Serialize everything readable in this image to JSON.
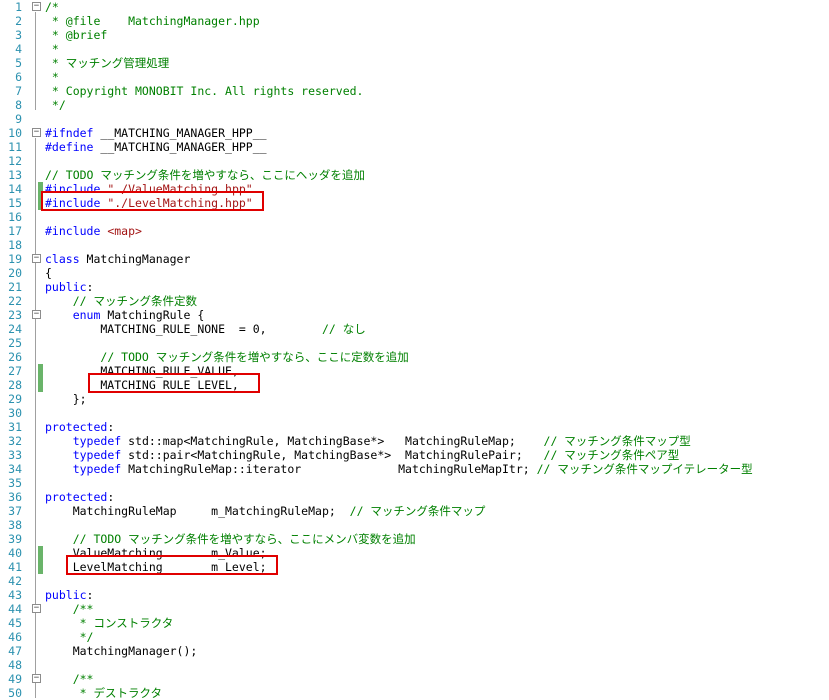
{
  "editor": {
    "language": "C++",
    "file": "MatchingManager.hpp",
    "lines": [
      {
        "n": "1",
        "fold": "-",
        "spans": [
          [
            "cm",
            "/*"
          ]
        ]
      },
      {
        "n": "2",
        "spans": [
          [
            "cm",
            " * @file    MatchingManager.hpp"
          ]
        ]
      },
      {
        "n": "3",
        "spans": [
          [
            "cm",
            " * @brief"
          ]
        ]
      },
      {
        "n": "4",
        "spans": [
          [
            "cm",
            " *"
          ]
        ]
      },
      {
        "n": "5",
        "spans": [
          [
            "cm",
            " * マッチング管理処理"
          ]
        ]
      },
      {
        "n": "6",
        "spans": [
          [
            "cm",
            " *"
          ]
        ]
      },
      {
        "n": "7",
        "spans": [
          [
            "cm",
            " * Copyright MONOBIT Inc. All rights reserved."
          ]
        ]
      },
      {
        "n": "8",
        "spans": [
          [
            "cm",
            " */"
          ]
        ]
      },
      {
        "n": "9",
        "spans": []
      },
      {
        "n": "10",
        "fold": "-",
        "spans": [
          [
            "pp",
            "#ifndef"
          ],
          [
            "tx",
            " __MATCHING_MANAGER_HPP__"
          ]
        ]
      },
      {
        "n": "11",
        "spans": [
          [
            "pp",
            "#define"
          ],
          [
            "tx",
            " __MATCHING_MANAGER_HPP__"
          ]
        ]
      },
      {
        "n": "12",
        "spans": []
      },
      {
        "n": "13",
        "spans": [
          [
            "cm",
            "// TODO マッチング条件を増やすなら、ここにヘッダを追加"
          ]
        ]
      },
      {
        "n": "14",
        "changed": true,
        "spans": [
          [
            "pp",
            "#include"
          ],
          [
            "tx",
            " "
          ],
          [
            "st",
            "\"./ValueMatching.hpp\""
          ]
        ]
      },
      {
        "n": "15",
        "changed": true,
        "spans": [
          [
            "pp",
            "#include"
          ],
          [
            "tx",
            " "
          ],
          [
            "st",
            "\"./LevelMatching.hpp\""
          ]
        ]
      },
      {
        "n": "16",
        "spans": []
      },
      {
        "n": "17",
        "spans": [
          [
            "pp",
            "#include"
          ],
          [
            "tx",
            " "
          ],
          [
            "st",
            "<map>"
          ]
        ]
      },
      {
        "n": "18",
        "spans": []
      },
      {
        "n": "19",
        "fold": "-",
        "spans": [
          [
            "kw",
            "class"
          ],
          [
            "tx",
            " MatchingManager"
          ]
        ]
      },
      {
        "n": "20",
        "spans": [
          [
            "tx",
            "{"
          ]
        ]
      },
      {
        "n": "21",
        "spans": [
          [
            "kw",
            "public"
          ],
          [
            "tx",
            ":"
          ]
        ]
      },
      {
        "n": "22",
        "spans": [
          [
            "tx",
            "    "
          ],
          [
            "cm",
            "// マッチング条件定数"
          ]
        ]
      },
      {
        "n": "23",
        "fold": "-",
        "spans": [
          [
            "tx",
            "    "
          ],
          [
            "kw",
            "enum"
          ],
          [
            "tx",
            " MatchingRule {"
          ]
        ]
      },
      {
        "n": "24",
        "spans": [
          [
            "tx",
            "        MATCHING_RULE_NONE  = 0,        "
          ],
          [
            "cm",
            "// なし"
          ]
        ]
      },
      {
        "n": "25",
        "spans": []
      },
      {
        "n": "26",
        "spans": [
          [
            "tx",
            "        "
          ],
          [
            "cm",
            "// TODO マッチング条件を増やすなら、ここに定数を追加"
          ]
        ]
      },
      {
        "n": "27",
        "changed": true,
        "spans": [
          [
            "tx",
            "        MATCHING_RULE_VALUE,"
          ]
        ]
      },
      {
        "n": "28",
        "changed": true,
        "spans": [
          [
            "tx",
            "        MATCHING_RULE_LEVEL,"
          ]
        ]
      },
      {
        "n": "29",
        "spans": [
          [
            "tx",
            "    };"
          ]
        ]
      },
      {
        "n": "30",
        "spans": []
      },
      {
        "n": "31",
        "spans": [
          [
            "kw",
            "protected"
          ],
          [
            "tx",
            ":"
          ]
        ]
      },
      {
        "n": "32",
        "spans": [
          [
            "tx",
            "    "
          ],
          [
            "kw",
            "typedef"
          ],
          [
            "tx",
            " std::map<MatchingRule, MatchingBase*>   MatchingRuleMap;    "
          ],
          [
            "cm",
            "// マッチング条件マップ型"
          ]
        ]
      },
      {
        "n": "33",
        "spans": [
          [
            "tx",
            "    "
          ],
          [
            "kw",
            "typedef"
          ],
          [
            "tx",
            " std::pair<MatchingRule, MatchingBase*>  MatchingRulePair;   "
          ],
          [
            "cm",
            "// マッチング条件ペア型"
          ]
        ]
      },
      {
        "n": "34",
        "spans": [
          [
            "tx",
            "    "
          ],
          [
            "kw",
            "typedef"
          ],
          [
            "tx",
            " MatchingRuleMap::iterator              MatchingRuleMapItr; "
          ],
          [
            "cm",
            "// マッチング条件マップイテレーター型"
          ]
        ]
      },
      {
        "n": "35",
        "spans": []
      },
      {
        "n": "36",
        "spans": [
          [
            "kw",
            "protected"
          ],
          [
            "tx",
            ":"
          ]
        ]
      },
      {
        "n": "37",
        "spans": [
          [
            "tx",
            "    MatchingRuleMap     m_MatchingRuleMap;  "
          ],
          [
            "cm",
            "// マッチング条件マップ"
          ]
        ]
      },
      {
        "n": "38",
        "spans": []
      },
      {
        "n": "39",
        "spans": [
          [
            "tx",
            "    "
          ],
          [
            "cm",
            "// TODO マッチング条件を増やすなら、ここにメンバ変数を追加"
          ]
        ]
      },
      {
        "n": "40",
        "changed": true,
        "spans": [
          [
            "tx",
            "    ValueMatching       m_Value;"
          ]
        ]
      },
      {
        "n": "41",
        "changed": true,
        "spans": [
          [
            "tx",
            "    LevelMatching       m_Level;"
          ]
        ]
      },
      {
        "n": "42",
        "spans": []
      },
      {
        "n": "43",
        "spans": [
          [
            "kw",
            "public"
          ],
          [
            "tx",
            ":"
          ]
        ]
      },
      {
        "n": "44",
        "fold": "-",
        "spans": [
          [
            "tx",
            "    "
          ],
          [
            "cm",
            "/**"
          ]
        ]
      },
      {
        "n": "45",
        "spans": [
          [
            "tx",
            "    "
          ],
          [
            "cm",
            " * コンストラクタ"
          ]
        ]
      },
      {
        "n": "46",
        "spans": [
          [
            "tx",
            "    "
          ],
          [
            "cm",
            " */"
          ]
        ]
      },
      {
        "n": "47",
        "spans": [
          [
            "tx",
            "    MatchingManager();"
          ]
        ]
      },
      {
        "n": "48",
        "spans": []
      },
      {
        "n": "49",
        "fold": "-",
        "spans": [
          [
            "tx",
            "    "
          ],
          [
            "cm",
            "/**"
          ]
        ]
      },
      {
        "n": "50",
        "spans": [
          [
            "tx",
            "    "
          ],
          [
            "cm",
            " * デストラクタ"
          ]
        ]
      }
    ],
    "highlights": [
      {
        "line": "15",
        "label": "include-levelmatching"
      },
      {
        "line": "28",
        "label": "rule-level"
      },
      {
        "line": "41",
        "label": "member-level"
      }
    ],
    "colors": {
      "line_number": "#2b91af",
      "keyword": "#0000ff",
      "comment": "#008000",
      "string": "#a31515",
      "changed_marker": "#6ab46a",
      "highlight_box": "#e00000"
    }
  }
}
